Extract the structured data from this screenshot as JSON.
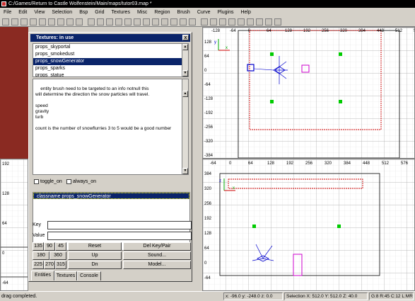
{
  "window": {
    "title": "C:/Games/Return to Castle Wolfenstein/Main/maps/tutor03.map *"
  },
  "menu": [
    "File",
    "Edit",
    "View",
    "Selection",
    "Bsp",
    "Grid",
    "Textures",
    "Misc",
    "Region",
    "Brush",
    "Curve",
    "Plugins",
    "Help"
  ],
  "views": {
    "top_ticks": [
      "-128",
      "-64",
      "0",
      "64",
      "128",
      "192",
      "256",
      "320",
      "384",
      "448",
      "512",
      "576"
    ],
    "top_left_ticks": [
      "128",
      "64",
      "0",
      "-64",
      "-128",
      "-192",
      "-256",
      "-320",
      "-384"
    ],
    "bottom_ticks": [
      "-64",
      "0",
      "64",
      "128",
      "192",
      "256",
      "320",
      "384",
      "448",
      "512",
      "576"
    ],
    "bottom_left_ticks": [
      "384",
      "320",
      "256",
      "192",
      "128",
      "64",
      "0",
      "-64"
    ],
    "left_view_ticks": [
      "192",
      "128",
      "64",
      "0",
      "-64"
    ],
    "axis_x": "x",
    "axis_y": "y",
    "axis_z": "z"
  },
  "dialog": {
    "title": "Textures: in use",
    "close": "x",
    "list_items": [
      "props_skyportal",
      "props_smokedust",
      "props_snowGenerator",
      "props_sparks",
      "props_statue"
    ],
    "selected_index": 2,
    "description": "entity brush need to be targeted to an info notnull this\nwill determine the direction the snow particles will travel.\n\nspeed\ngravity\nturb\n\ncount is the number of snowflurries 3 to 5 would be a good number\n\n",
    "checks": [
      "toggle_on",
      "always_on"
    ],
    "kv_row": "classname  props_snowGenerator",
    "key_label": "Key",
    "value_label": "Value",
    "angles": [
      "135",
      "90",
      "45",
      "180",
      "360",
      "225",
      "270",
      "315"
    ],
    "buttons": {
      "reset": "Reset",
      "up": "Up",
      "dn": "Dn",
      "del": "Del Key/Pair",
      "sound": "Sound...",
      "model": "Model..."
    },
    "tabs": [
      "Entities",
      "Textures",
      "Console"
    ]
  },
  "status": {
    "message": "drag completed.",
    "coords": "x: -96.0  y: -248.0  z: 0.0",
    "selection": "Selection X: 512.0  Y: 512.0  Z: 40.0",
    "grid": "G:8 R:45 C:12 L:MR"
  },
  "colors": {
    "selection": "#0a246a",
    "brush_red": "#cc0000",
    "entity_green": "#00cc00",
    "grid": "#d8d8d8"
  }
}
